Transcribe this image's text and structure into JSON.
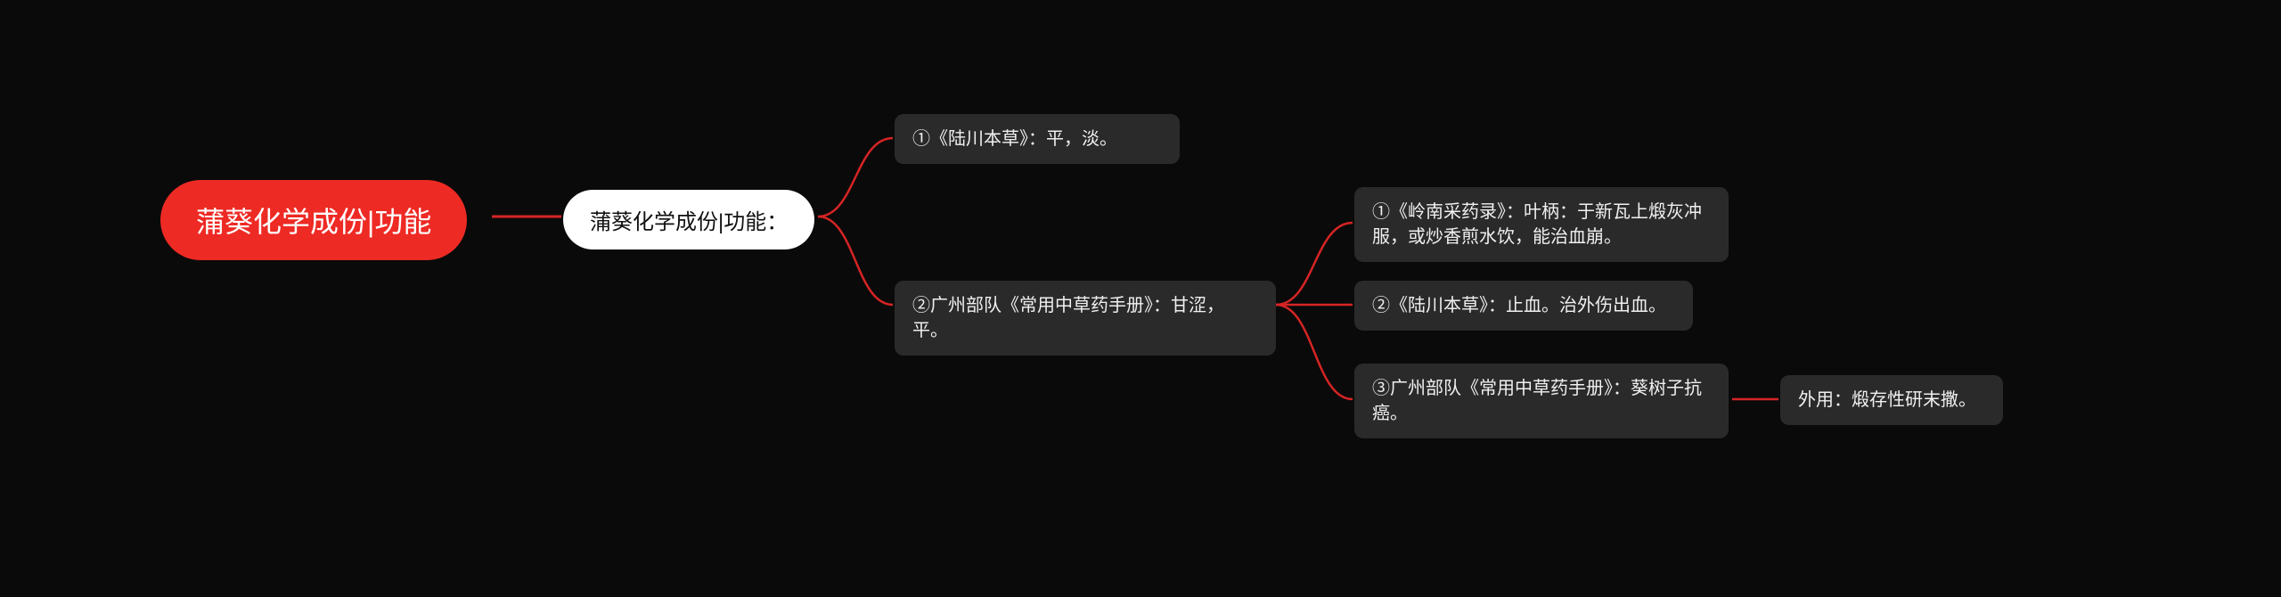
{
  "root": {
    "text": "蒲葵化学成份|功能"
  },
  "level1": {
    "text": "蒲葵化学成份|功能："
  },
  "level2a": {
    "text": "①《陆川本草》：平，淡。"
  },
  "level2b": {
    "text": "②广州部队《常用中草药手册》：甘涩，平。"
  },
  "level3a": {
    "text": "①《岭南采药录》：叶柄：于新瓦上煅灰冲服，或炒香煎水饮，能治血崩。"
  },
  "level3b": {
    "text": "②《陆川本草》：止血。治外伤出血。"
  },
  "level3c": {
    "text": "③广州部队《常用中草药手册》：葵树子抗癌。"
  },
  "level4": {
    "text": "外用：煅存性研末撒。"
  },
  "colors": {
    "connector": "#d62424"
  }
}
